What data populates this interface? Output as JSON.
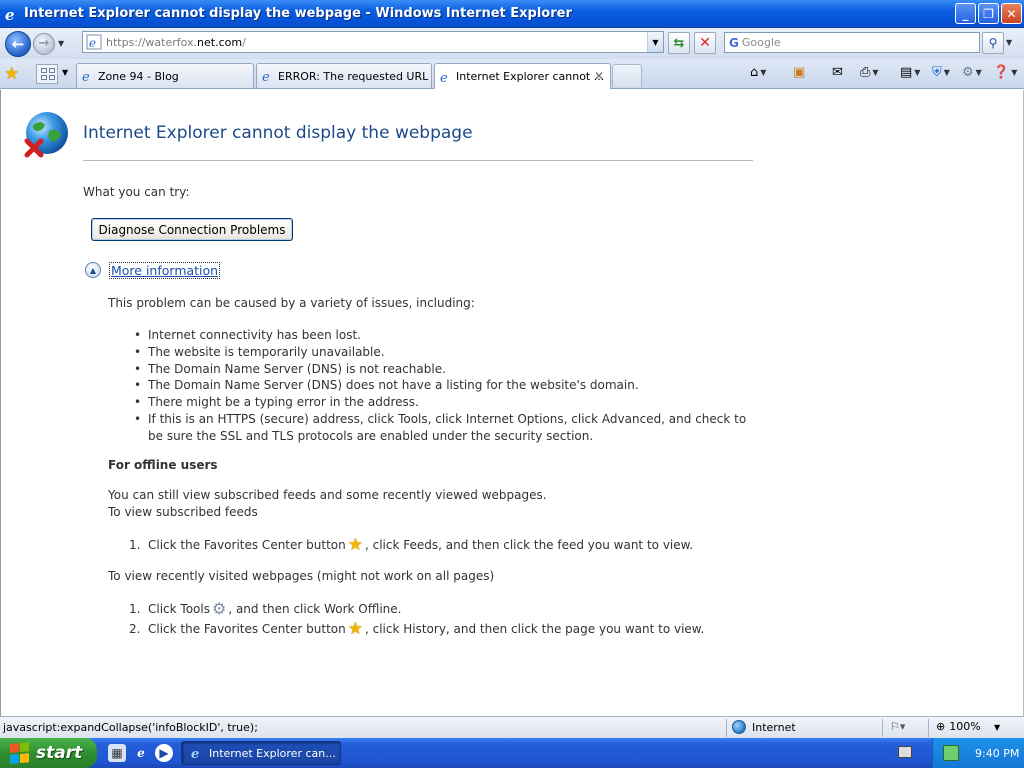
{
  "window": {
    "title": "Internet Explorer cannot display the webpage - Windows Internet Explorer",
    "minimize": "_",
    "restore": "❐",
    "close": "✕"
  },
  "nav": {
    "address": "https://waterfox.net.com/",
    "address_prefix": "https://waterfox.",
    "address_domain": "net.com",
    "address_suffix": "/",
    "search_placeholder": "Google"
  },
  "tabs": [
    {
      "label": "Zone 94 - Blog",
      "active": false
    },
    {
      "label": "ERROR: The requested URL ...",
      "active": false
    },
    {
      "label": "Internet Explorer cannot ...",
      "active": true
    }
  ],
  "content": {
    "heading": "Internet Explorer cannot display the webpage",
    "what_try": "What you can try:",
    "diagnose_button": "Diagnose Connection Problems",
    "more_info": "More information",
    "problem_intro": "This problem can be caused by a variety of issues, including:",
    "bullets": [
      "Internet connectivity has been lost.",
      "The website is temporarily unavailable.",
      "The Domain Name Server (DNS) is not reachable.",
      "The Domain Name Server (DNS) does not have a listing for the website's domain.",
      "There might be a typing error in the address.",
      "If this is an HTTPS (secure) address, click Tools, click Internet Options, click Advanced, and check to be sure the SSL and TLS protocols are enabled under the security section."
    ],
    "offline_heading": "For offline users",
    "offline_p1": "You can still view subscribed feeds and some recently viewed webpages.",
    "offline_p2": "To view subscribed feeds",
    "feeds_steps": [
      {
        "num": "1.",
        "before": "Click the Favorites Center button",
        "after": ", click Feeds, and then click the feed you want to view."
      }
    ],
    "recent_intro": "To view recently visited webpages (might not work on all pages)",
    "recent_steps": [
      {
        "num": "1.",
        "before": "Click Tools",
        "after": ", and then click Work Offline.",
        "icon": "gear-icon"
      },
      {
        "num": "2.",
        "before": "Click the Favorites Center button",
        "after": ", click History, and then click the page you want to view.",
        "icon": "star-icon"
      }
    ]
  },
  "status": {
    "text": "javascript:expandCollapse('infoBlockID', true);",
    "zone": "Internet",
    "zoom": "100%"
  },
  "taskbar": {
    "start": "start",
    "task": "Internet Explorer can...",
    "clock": "9:40 PM"
  },
  "colors": {
    "title_bar": "#0653d6",
    "heading": "#1c4a88",
    "link": "#1c4fb0",
    "start_green": "#2f8f2f"
  }
}
